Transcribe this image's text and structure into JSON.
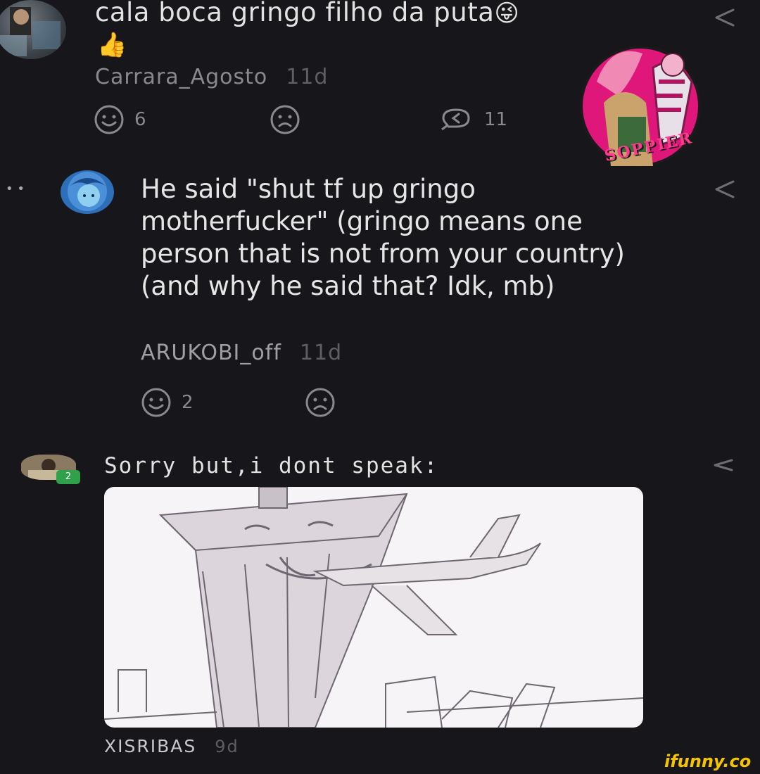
{
  "comments": [
    {
      "text": "cala boca gringo filho da puta",
      "reaction_emojis": [
        "😜",
        "👍"
      ],
      "user": "Carrara_Agosto",
      "time": "11d",
      "smile_count": "6",
      "reply_count": "11"
    },
    {
      "text": "He said \"shut tf up gringo motherfucker\" (gringo means one person that is not from your country) (and why he said that? Idk, mb)",
      "user": "ARUKOBI_off",
      "time": "11d",
      "smile_count": "2"
    },
    {
      "text": "Sorry but,i dont speak:",
      "user": "XISRIBAS",
      "time": "9d",
      "avatar_badge": "2"
    }
  ],
  "sticker_text": "SOPPIER",
  "watermark": "ifunny.co",
  "more_dots": "• •"
}
